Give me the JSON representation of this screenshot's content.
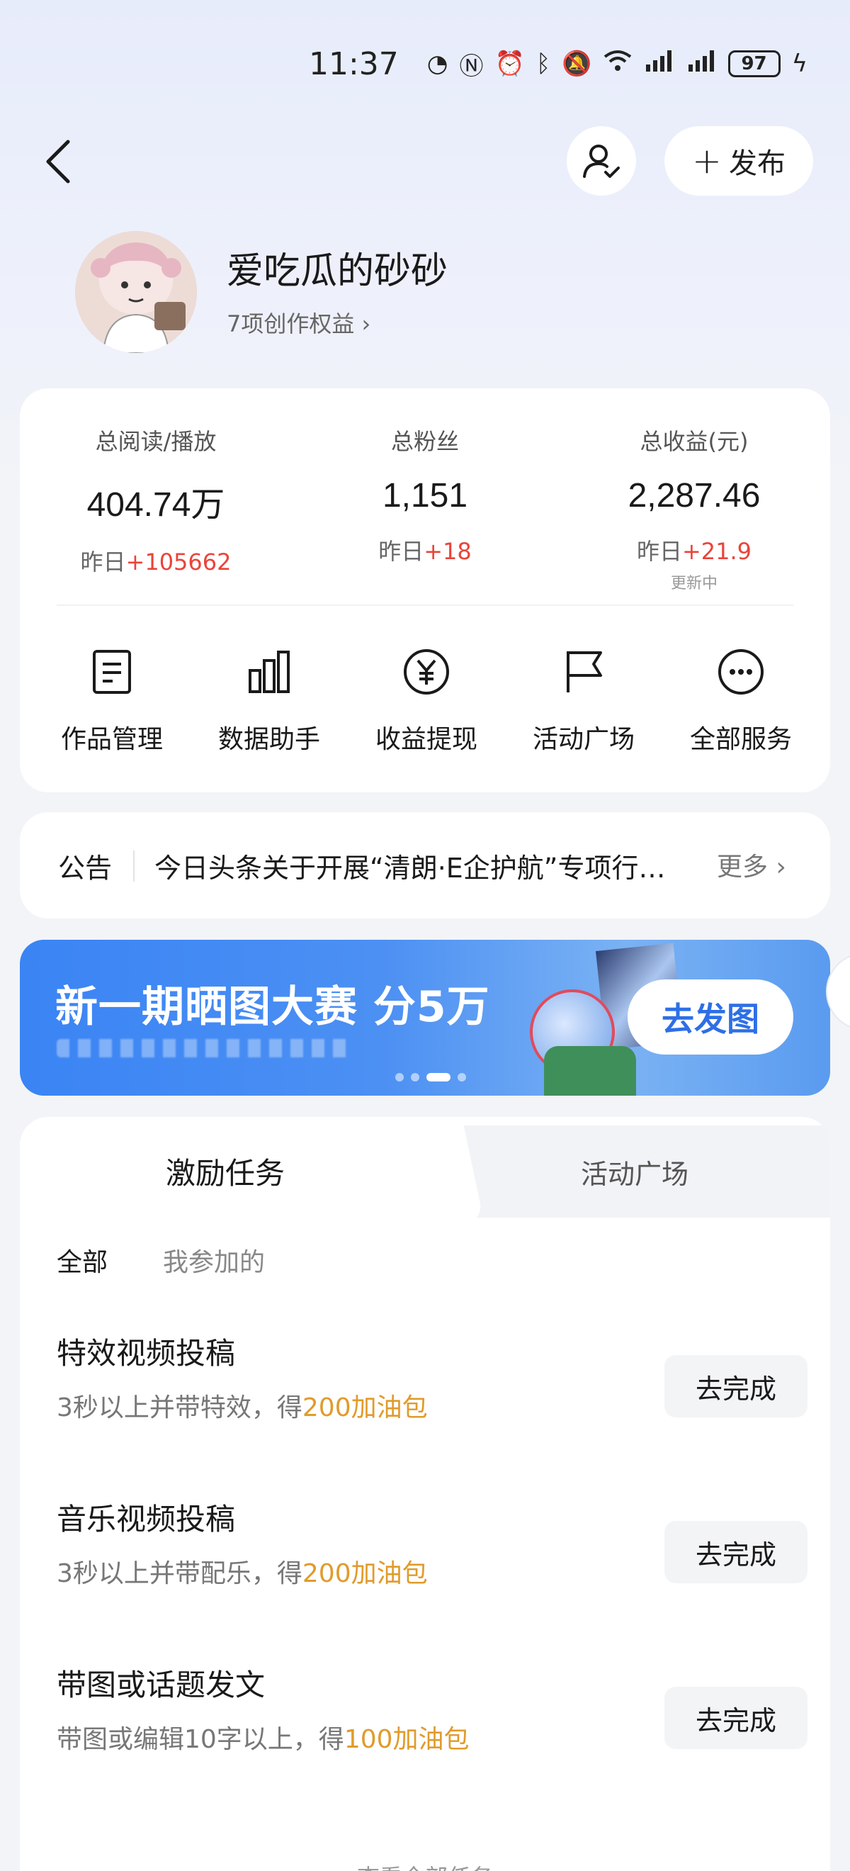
{
  "status_bar": {
    "time": "11:37",
    "battery": "97"
  },
  "header": {
    "publish_label": "发布"
  },
  "profile": {
    "name": "爱吃瓜的砂砂",
    "rights": "7项创作权益"
  },
  "stats": [
    {
      "label": "总阅读/播放",
      "value": "404.74万",
      "delta_prefix": "昨日",
      "delta": "+105662",
      "note": ""
    },
    {
      "label": "总粉丝",
      "value": "1,151",
      "delta_prefix": "昨日",
      "delta": "+18",
      "note": ""
    },
    {
      "label": "总收益(元)",
      "value": "2,287.46",
      "delta_prefix": "昨日",
      "delta": "+21.9",
      "note": "更新中"
    }
  ],
  "tools": [
    {
      "label": "作品管理",
      "icon": "document-icon"
    },
    {
      "label": "数据助手",
      "icon": "bar-chart-icon"
    },
    {
      "label": "收益提现",
      "icon": "yen-icon"
    },
    {
      "label": "活动广场",
      "icon": "flag-icon"
    },
    {
      "label": "全部服务",
      "icon": "more-icon"
    }
  ],
  "notice": {
    "tag": "公告",
    "text": "今日头条关于开展“清朗·E企护航”专项行动的公告",
    "more": "更多"
  },
  "banner": {
    "title": "新一期晒图大赛 分5万",
    "button": "去发图"
  },
  "tasks_panel": {
    "tabs": [
      "激励任务",
      "活动广场"
    ],
    "filters": [
      "全部",
      "我参加的"
    ],
    "tasks": [
      {
        "title": "特效视频投稿",
        "desc_prefix": "3秒以上并带特效，得",
        "reward": "200加油包",
        "button": "去完成"
      },
      {
        "title": "音乐视频投稿",
        "desc_prefix": "3秒以上并带配乐，得",
        "reward": "200加油包",
        "button": "去完成"
      },
      {
        "title": "带图或话题发文",
        "desc_prefix": "带图或编辑10字以上，得",
        "reward": "100加油包",
        "button": "去完成"
      }
    ],
    "view_all": "查看全部任务"
  },
  "colors": {
    "accent_red": "#e9443a",
    "reward_orange": "#e09b2c",
    "banner_blue": "#3a84f4"
  }
}
